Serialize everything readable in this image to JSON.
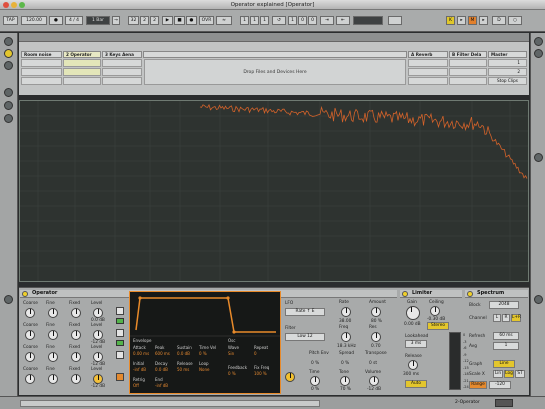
{
  "window": {
    "title": "Operator explained  [Operator]"
  },
  "transport": {
    "tap": "TAP",
    "tempo": "120.00",
    "signature": "4 / 4",
    "quantize": "1 Bar",
    "position": [
      "32",
      "2",
      "2"
    ],
    "loop_start": [
      "1",
      "1",
      "1"
    ],
    "loop_length": [
      "1",
      "0",
      "0"
    ],
    "ovr": "OVR",
    "key": "K",
    "midi": "MIDI",
    "cpu": "D"
  },
  "session": {
    "tracks": [
      {
        "label": "Room noise"
      },
      {
        "label": "2 Operator"
      },
      {
        "label": "3 Keys Aena"
      },
      {
        "label": ""
      },
      {
        "label": "A Reverb"
      },
      {
        "label": "B Filter Dela"
      },
      {
        "label": "Master"
      }
    ],
    "drop_text": "Drop Files and Devices Here",
    "stop_clips": "Stop Clips",
    "master_rows": [
      "1",
      "2"
    ]
  },
  "operator": {
    "title": "Operator",
    "osc_labels": [
      "Coarse",
      "Fine",
      "Fixed",
      "Level"
    ],
    "osc_levels": [
      "0.0 dB",
      "-12 dB",
      "-12 dB",
      "-12 dB"
    ],
    "envelope": {
      "label": "Envelope",
      "params": [
        "Attack",
        "Peak",
        "Sustain",
        "Time Vel",
        "Initial",
        "Decay",
        "Release",
        "Loop",
        "Retrig",
        "End"
      ],
      "values": [
        "0.00 ms",
        "600 ms",
        "0.0 dB",
        "0 %",
        "-inf dB",
        "0.0 dB",
        "50 ms",
        "None",
        "Off",
        "-inf dB"
      ]
    },
    "osc": {
      "label": "Osc",
      "params": [
        "Wave",
        "Repeat",
        "Feedback",
        "Fix Freq"
      ],
      "values": [
        "Sin",
        "0",
        "0 %",
        "100 %"
      ]
    },
    "lfo": {
      "label": "LFO",
      "mode": "Rate ↑ E",
      "rate_label": "Rate",
      "rate_value": "38.00",
      "amount_label": "Amount",
      "amount_value": "80 %"
    },
    "filter": {
      "label": "Filter",
      "type": "Low 12",
      "freq_label": "Freq",
      "freq_value": "18.3 kHz",
      "res_label": "Res",
      "res_value": "0.70"
    },
    "pitch": {
      "env_label": "Pitch Env",
      "env_value": "0 %",
      "spread_label": "Spread",
      "spread_value": "0 %",
      "transpose_label": "Transpose",
      "transpose_value": "0 st"
    },
    "global": {
      "time_label": "Time",
      "time_value": "0 %",
      "tone_label": "Tone",
      "tone_value": "70 %",
      "volume_label": "Volume",
      "volume_value": "-12 dB"
    }
  },
  "limiter": {
    "title": "Limiter",
    "gain_label": "Gain",
    "gain_value": "0.00 dB",
    "ceiling_label": "Ceiling",
    "ceiling_value": "-0.30 dB",
    "stereo": "Stereo",
    "lookahead_label": "Lookahead",
    "lookahead_value": "3 ms",
    "release_label": "Release",
    "release_value": "300 ms",
    "auto": "Auto",
    "meter_labels": [
      "0",
      "-3",
      "-6",
      "-9",
      "-12",
      "-15",
      "-18",
      "-21",
      "-24"
    ]
  },
  "spectrum_device": {
    "title": "Spectrum",
    "block_label": "Block",
    "block_value": "2048",
    "channel_label": "Channel",
    "channel_options": [
      "L",
      "R",
      "L+R"
    ],
    "refresh_label": "Refresh",
    "refresh_value": "60 ms",
    "avg_label": "Avg",
    "avg_value": "1",
    "graph_label": "Graph",
    "graph_value": "Line",
    "scale_label": "Scale X",
    "scale_options": [
      "Lin",
      "Log",
      "ST"
    ],
    "range_label": "Range",
    "range_value": "-120"
  },
  "footer": {
    "track_name": "2-Operator"
  },
  "colors": {
    "spectrum_line": "#d2622a",
    "accent_yellow": "#e3c62d",
    "accent_orange": "#e58a2e",
    "accent_green": "#53b34b"
  }
}
